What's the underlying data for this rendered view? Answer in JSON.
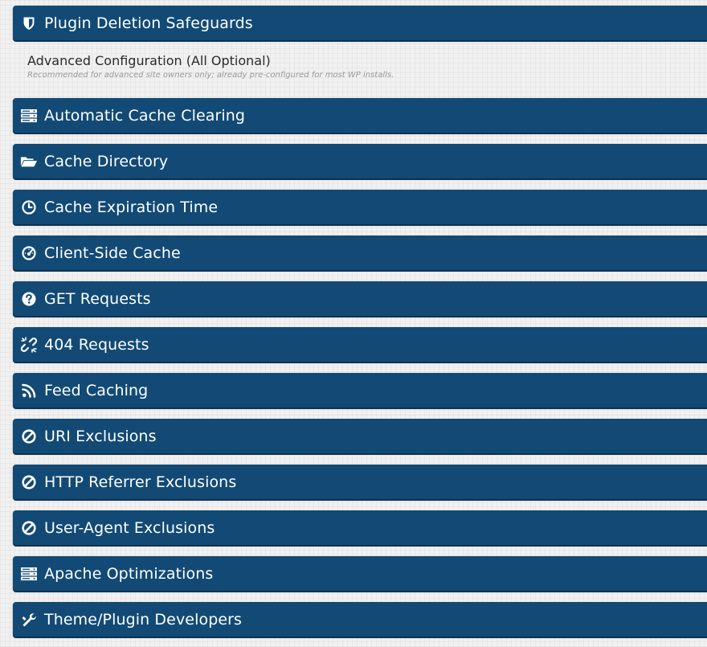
{
  "top_panel": {
    "label": "Plugin Deletion Safeguards",
    "icon": "shield-icon"
  },
  "advanced_section": {
    "title": "Advanced Configuration (All Optional)",
    "subtitle": "Recommended for advanced site owners only; already pre-configured for most WP installs."
  },
  "panels": [
    {
      "label": "Automatic Cache Clearing",
      "icon": "server-icon"
    },
    {
      "label": "Cache Directory",
      "icon": "folder-open-icon"
    },
    {
      "label": "Cache Expiration Time",
      "icon": "clock-icon"
    },
    {
      "label": "Client-Side Cache",
      "icon": "dashboard-icon"
    },
    {
      "label": "GET Requests",
      "icon": "question-circle-icon"
    },
    {
      "label": "404 Requests",
      "icon": "broken-link-icon"
    },
    {
      "label": "Feed Caching",
      "icon": "rss-icon"
    },
    {
      "label": "URI Exclusions",
      "icon": "ban-icon"
    },
    {
      "label": "HTTP Referrer Exclusions",
      "icon": "ban-icon"
    },
    {
      "label": "User-Agent Exclusions",
      "icon": "ban-icon"
    },
    {
      "label": "Apache Optimizations",
      "icon": "server-icon"
    },
    {
      "label": "Theme/Plugin Developers",
      "icon": "wrench-icon"
    }
  ],
  "colors": {
    "panel_bg": "#124a75",
    "panel_text": "#ffffff",
    "page_bg": "#f1f1f1"
  }
}
